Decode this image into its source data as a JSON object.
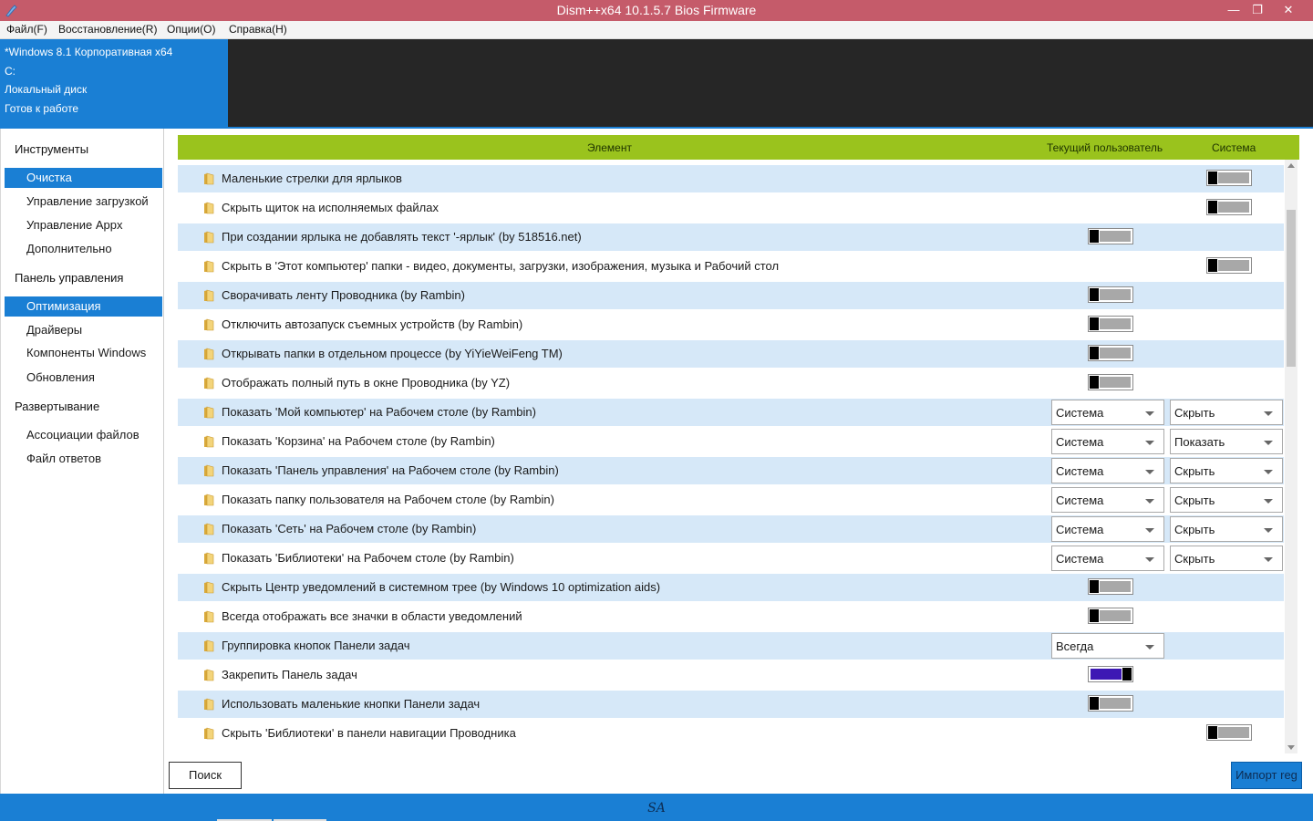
{
  "window": {
    "title": "Dism++x64 10.1.5.7 Bios Firmware",
    "minimize": "—",
    "maximize": "❐",
    "close": "✕"
  },
  "menu": {
    "file": "Файл(F)",
    "restore": "Восстановление(R)",
    "options": "Опции(O)",
    "help": "Справка(H)"
  },
  "info": {
    "os": "*Windows 8.1 Корпоративная x64",
    "drive": "C:",
    "disk": "Локальный диск",
    "status": "Готов к работе"
  },
  "sidebar": {
    "tools_header": "Инструменты",
    "cleanup": "Очистка",
    "boot_mgmt": "Управление загрузкой",
    "appx_mgmt": "Управление Appx",
    "additional": "Дополнительно",
    "control_header": "Панель управления",
    "optimization": "Оптимизация",
    "drivers": "Драйверы",
    "components": "Компоненты Windows",
    "updates": "Обновления",
    "deploy_header": "Развертывание",
    "file_assoc": "Ассоциации файлов",
    "answer_file": "Файл ответов"
  },
  "table": {
    "col_element": "Элемент",
    "col_current_user": "Текущий пользователь",
    "col_system": "Система"
  },
  "rows": [
    {
      "label": "Маленькие стрелки для ярлыков",
      "user_toggle": null,
      "sys_toggle": "off"
    },
    {
      "label": "Скрыть щиток на исполняемых файлах",
      "user_toggle": null,
      "sys_toggle": "off"
    },
    {
      "label": "При создании ярлыка не добавлять текст '-ярлык' (by 518516.net)",
      "user_toggle": "off",
      "sys_toggle": null
    },
    {
      "label": "Скрыть в 'Этот компьютер' папки - видео, документы, загрузки, изображения, музыка и Рабочий стол",
      "user_toggle": null,
      "sys_toggle": "off"
    },
    {
      "label": "Сворачивать ленту Проводника (by Rambin)",
      "user_toggle": "off",
      "sys_toggle": null
    },
    {
      "label": "Отключить автозапуск съемных устройств (by Rambin)",
      "user_toggle": "off",
      "sys_toggle": null
    },
    {
      "label": "Открывать папки в отдельном процессе (by YiYieWeiFeng TM)",
      "user_toggle": "off",
      "sys_toggle": null
    },
    {
      "label": "Отображать полный путь в окне Проводника (by YZ)",
      "user_toggle": "off",
      "sys_toggle": null
    },
    {
      "label": "Показать 'Мой компьютер' на Рабочем столе (by Rambin)",
      "select1": "Система",
      "select2": "Скрыть"
    },
    {
      "label": "Показать 'Корзина' на Рабочем столе (by Rambin)",
      "select1": "Система",
      "select2": "Показать"
    },
    {
      "label": "Показать 'Панель управления' на Рабочем столе (by Rambin)",
      "select1": "Система",
      "select2": "Скрыть"
    },
    {
      "label": "Показать папку пользователя на Рабочем столе (by Rambin)",
      "select1": "Система",
      "select2": "Скрыть"
    },
    {
      "label": "Показать 'Сеть' на Рабочем столе (by Rambin)",
      "select1": "Система",
      "select2": "Скрыть"
    },
    {
      "label": "Показать 'Библиотеки' на Рабочем столе (by Rambin)",
      "select1": "Система",
      "select2": "Скрыть"
    },
    {
      "label": "Скрыть Центр уведомлений в системном трее (by Windows 10 optimization aids)",
      "user_toggle": "off",
      "sys_toggle": null
    },
    {
      "label": "Всегда отображать все значки в области уведомлений",
      "user_toggle": "off",
      "sys_toggle": null
    },
    {
      "label": "Группировка кнопок Панели задач",
      "select1": "Всегда"
    },
    {
      "label": "Закрепить Панель задач",
      "user_toggle": "on",
      "sys_toggle": null
    },
    {
      "label": "Использовать маленькие кнопки Панели задач",
      "user_toggle": "off",
      "sys_toggle": null
    },
    {
      "label": "Скрыть 'Библиотеки' в панели навигации Проводника",
      "user_toggle": null,
      "sys_toggle": "off"
    }
  ],
  "buttons": {
    "search": "Поиск",
    "import_reg": "Импорт reg"
  },
  "statusbar": {
    "text": "SA"
  },
  "colors": {
    "titlebar": "#c55b6a",
    "accent": "#1a7fd4",
    "header_green": "#9ac31d",
    "row_shade": "#d6e8f8",
    "toggle_on": "#3d18b4"
  },
  "icons": {
    "row_icon": "folder-icon",
    "app_icon": "dism-app-icon"
  }
}
